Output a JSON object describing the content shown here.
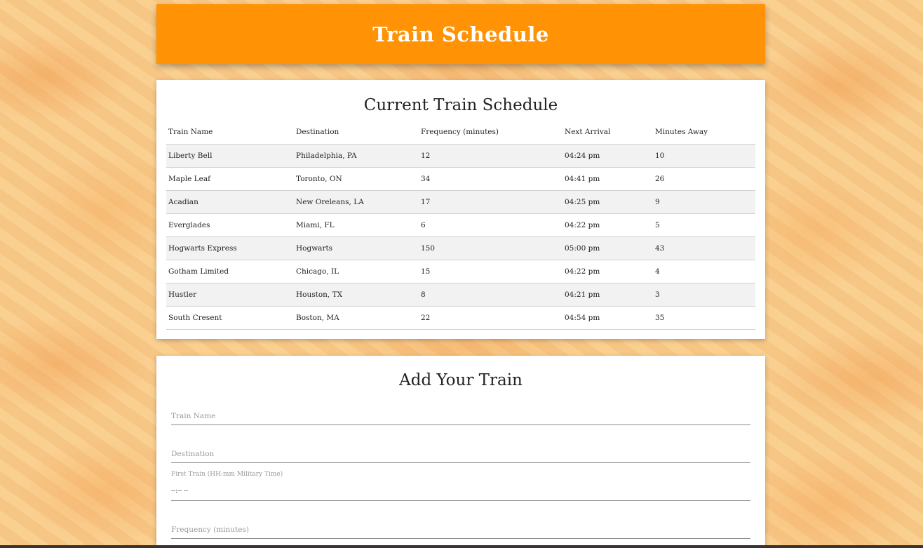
{
  "header": {
    "title": "Train Schedule"
  },
  "schedule": {
    "title": "Current Train Schedule",
    "columns": [
      "Train Name",
      "Destination",
      "Frequency (minutes)",
      "Next Arrival",
      "Minutes Away"
    ],
    "rows": [
      [
        "Liberty Bell",
        "Philadelphia, PA",
        "12",
        "04:24 pm",
        "10"
      ],
      [
        "Maple Leaf",
        "Toronto, ON",
        "34",
        "04:41 pm",
        "26"
      ],
      [
        "Acadian",
        "New Oreleans, LA",
        "17",
        "04:25 pm",
        "9"
      ],
      [
        "Everglades",
        "Miami, FL",
        "6",
        "04:22 pm",
        "5"
      ],
      [
        "Hogwarts Express",
        "Hogwarts",
        "150",
        "05:00 pm",
        "43"
      ],
      [
        "Gotham Limited",
        "Chicago, IL",
        "15",
        "04:22 pm",
        "4"
      ],
      [
        "Hustler",
        "Houston, TX",
        "8",
        "04:21 pm",
        "3"
      ],
      [
        "South Cresent",
        "Boston, MA",
        "22",
        "04:54 pm",
        "35"
      ]
    ]
  },
  "form": {
    "title": "Add Your Train",
    "train_name_placeholder": "Train Name",
    "destination_placeholder": "Destination",
    "first_train_label": "First Train (HH:mm Military Time)",
    "first_train_value": "--:-- --",
    "frequency_placeholder": "Frequency (minutes)"
  },
  "colors": {
    "header_bg": "#ff9205",
    "header_text": "#ffffff",
    "stripe_row": "#f2f2f2"
  }
}
